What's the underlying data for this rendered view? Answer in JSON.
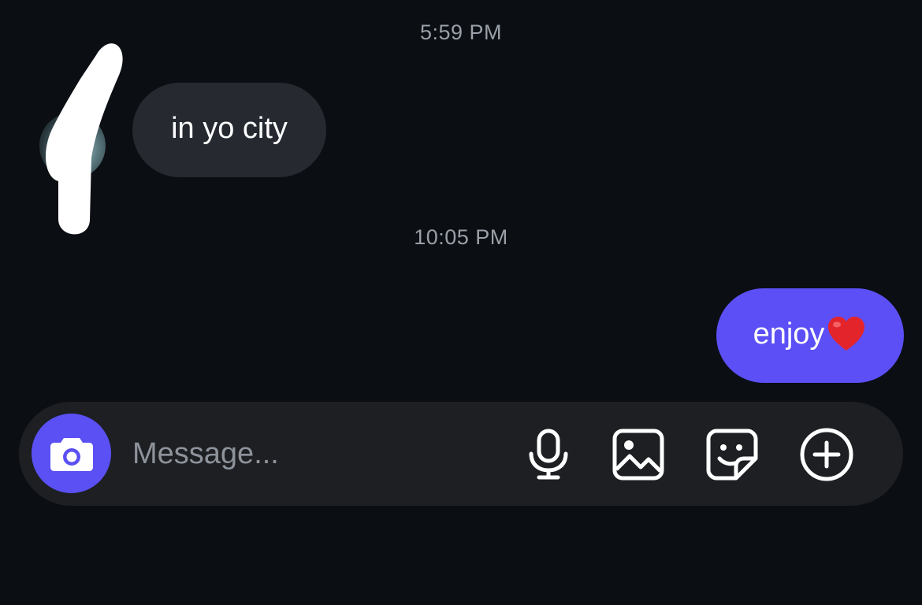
{
  "conversation": {
    "messages": [
      {
        "timestamp": "5:59 PM",
        "direction": "incoming",
        "text": "in yo city"
      },
      {
        "timestamp": "10:05 PM",
        "direction": "outgoing",
        "text": "enjoy",
        "emoji": "red-heart"
      }
    ]
  },
  "composer": {
    "placeholder": "Message...",
    "value": "",
    "icons": [
      "camera-icon",
      "microphone-icon",
      "gallery-icon",
      "sticker-icon",
      "plus-icon"
    ]
  },
  "colors": {
    "background": "#0b0e13",
    "incoming_bubble": "#262a30",
    "outgoing_bubble": "#5b4ff5",
    "composer": "#1d1f23",
    "timestamp": "#9aa0a8"
  }
}
